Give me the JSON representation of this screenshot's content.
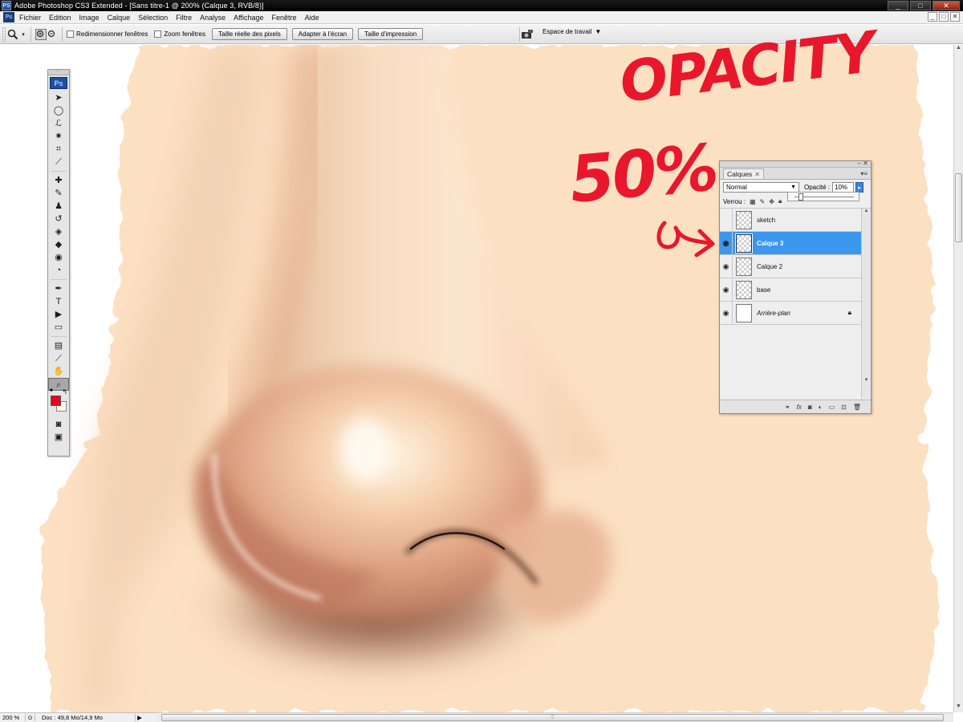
{
  "window": {
    "app_icon": "PS",
    "title": "Adobe Photoshop CS3 Extended - [Sans titre-1 @ 200% (Calque 3, RVB/8)]",
    "buttons": [
      "_",
      "□",
      "✕"
    ]
  },
  "menubar": {
    "icon": "Ps",
    "items": [
      "Fichier",
      "Edition",
      "Image",
      "Calque",
      "Sélection",
      "Filtre",
      "Analyse",
      "Affichage",
      "Fenêtre",
      "Aide"
    ],
    "doc_buttons": [
      "_",
      "□",
      "✕"
    ]
  },
  "options_bar": {
    "tool_icon": "zoom-icon",
    "checkbox_resize": "Redimensionner fenêtres",
    "checkbox_zoom": "Zoom fenêtres",
    "btn_actual": "Taille réelle des pixels",
    "btn_fit": "Adapter à l'écran",
    "btn_print": "Taille d'impression",
    "workspace_label": "Espace de travail"
  },
  "toolbox": {
    "logo": "Ps",
    "tools": [
      {
        "name": "move-tool-icon",
        "glyph": "➤"
      },
      {
        "name": "marquee-tool-icon",
        "glyph": "◯"
      },
      {
        "name": "lasso-tool-icon",
        "glyph": "ℒ"
      },
      {
        "name": "magic-wand-tool-icon",
        "glyph": "✷"
      },
      {
        "name": "crop-tool-icon",
        "glyph": "⌗"
      },
      {
        "name": "eyedropper-slice-tool-icon",
        "glyph": "⟋"
      },
      {
        "name": "healing-brush-tool-icon",
        "glyph": "✚"
      },
      {
        "name": "brush-tool-icon",
        "glyph": "✎"
      },
      {
        "name": "stamp-tool-icon",
        "glyph": "♟"
      },
      {
        "name": "history-brush-tool-icon",
        "glyph": "↺"
      },
      {
        "name": "eraser-tool-icon",
        "glyph": "◈"
      },
      {
        "name": "paint-bucket-tool-icon",
        "glyph": "◆"
      },
      {
        "name": "blur-tool-icon",
        "glyph": "◉"
      },
      {
        "name": "dodge-tool-icon",
        "glyph": "◔"
      },
      {
        "name": "pen-tool-icon",
        "glyph": "✒"
      },
      {
        "name": "type-tool-icon",
        "glyph": "T"
      },
      {
        "name": "path-selection-tool-icon",
        "glyph": "▶"
      },
      {
        "name": "shape-tool-icon",
        "glyph": "▭"
      },
      {
        "name": "notes-tool-icon",
        "glyph": "▤"
      },
      {
        "name": "eyedropper-tool-icon",
        "glyph": "⟋"
      },
      {
        "name": "hand-tool-icon",
        "glyph": "✋"
      },
      {
        "name": "zoom-tool-icon",
        "glyph": "⌕"
      }
    ],
    "foreground_color": "#e8001c",
    "background_color": "#fffbe6"
  },
  "layers_panel": {
    "tab_label": "Calques",
    "blend_mode": "Normal",
    "opacity_label": "Opacité :",
    "opacity_value": "10%",
    "opacity_slider_fraction": 0.1,
    "lock_label": "Verrou :",
    "layers": [
      {
        "name": "sketch",
        "visible": false,
        "selected": false,
        "italic": false,
        "locked": false,
        "transparent_thumb": true
      },
      {
        "name": "Calque 3",
        "visible": true,
        "selected": true,
        "italic": false,
        "locked": false,
        "transparent_thumb": true
      },
      {
        "name": "Calque 2",
        "visible": true,
        "selected": false,
        "italic": false,
        "locked": false,
        "transparent_thumb": true
      },
      {
        "name": "base",
        "visible": true,
        "selected": false,
        "italic": false,
        "locked": false,
        "transparent_thumb": true
      },
      {
        "name": "Arrière-plan",
        "visible": true,
        "selected": false,
        "italic": true,
        "locked": true,
        "transparent_thumb": false
      }
    ]
  },
  "annotation": {
    "line1": "OPACITY",
    "line2": "50%",
    "color": "#e8172c"
  },
  "status_bar": {
    "zoom": "200 %",
    "doc_info": "Doc : 49,8 Mo/14,9 Mo"
  }
}
